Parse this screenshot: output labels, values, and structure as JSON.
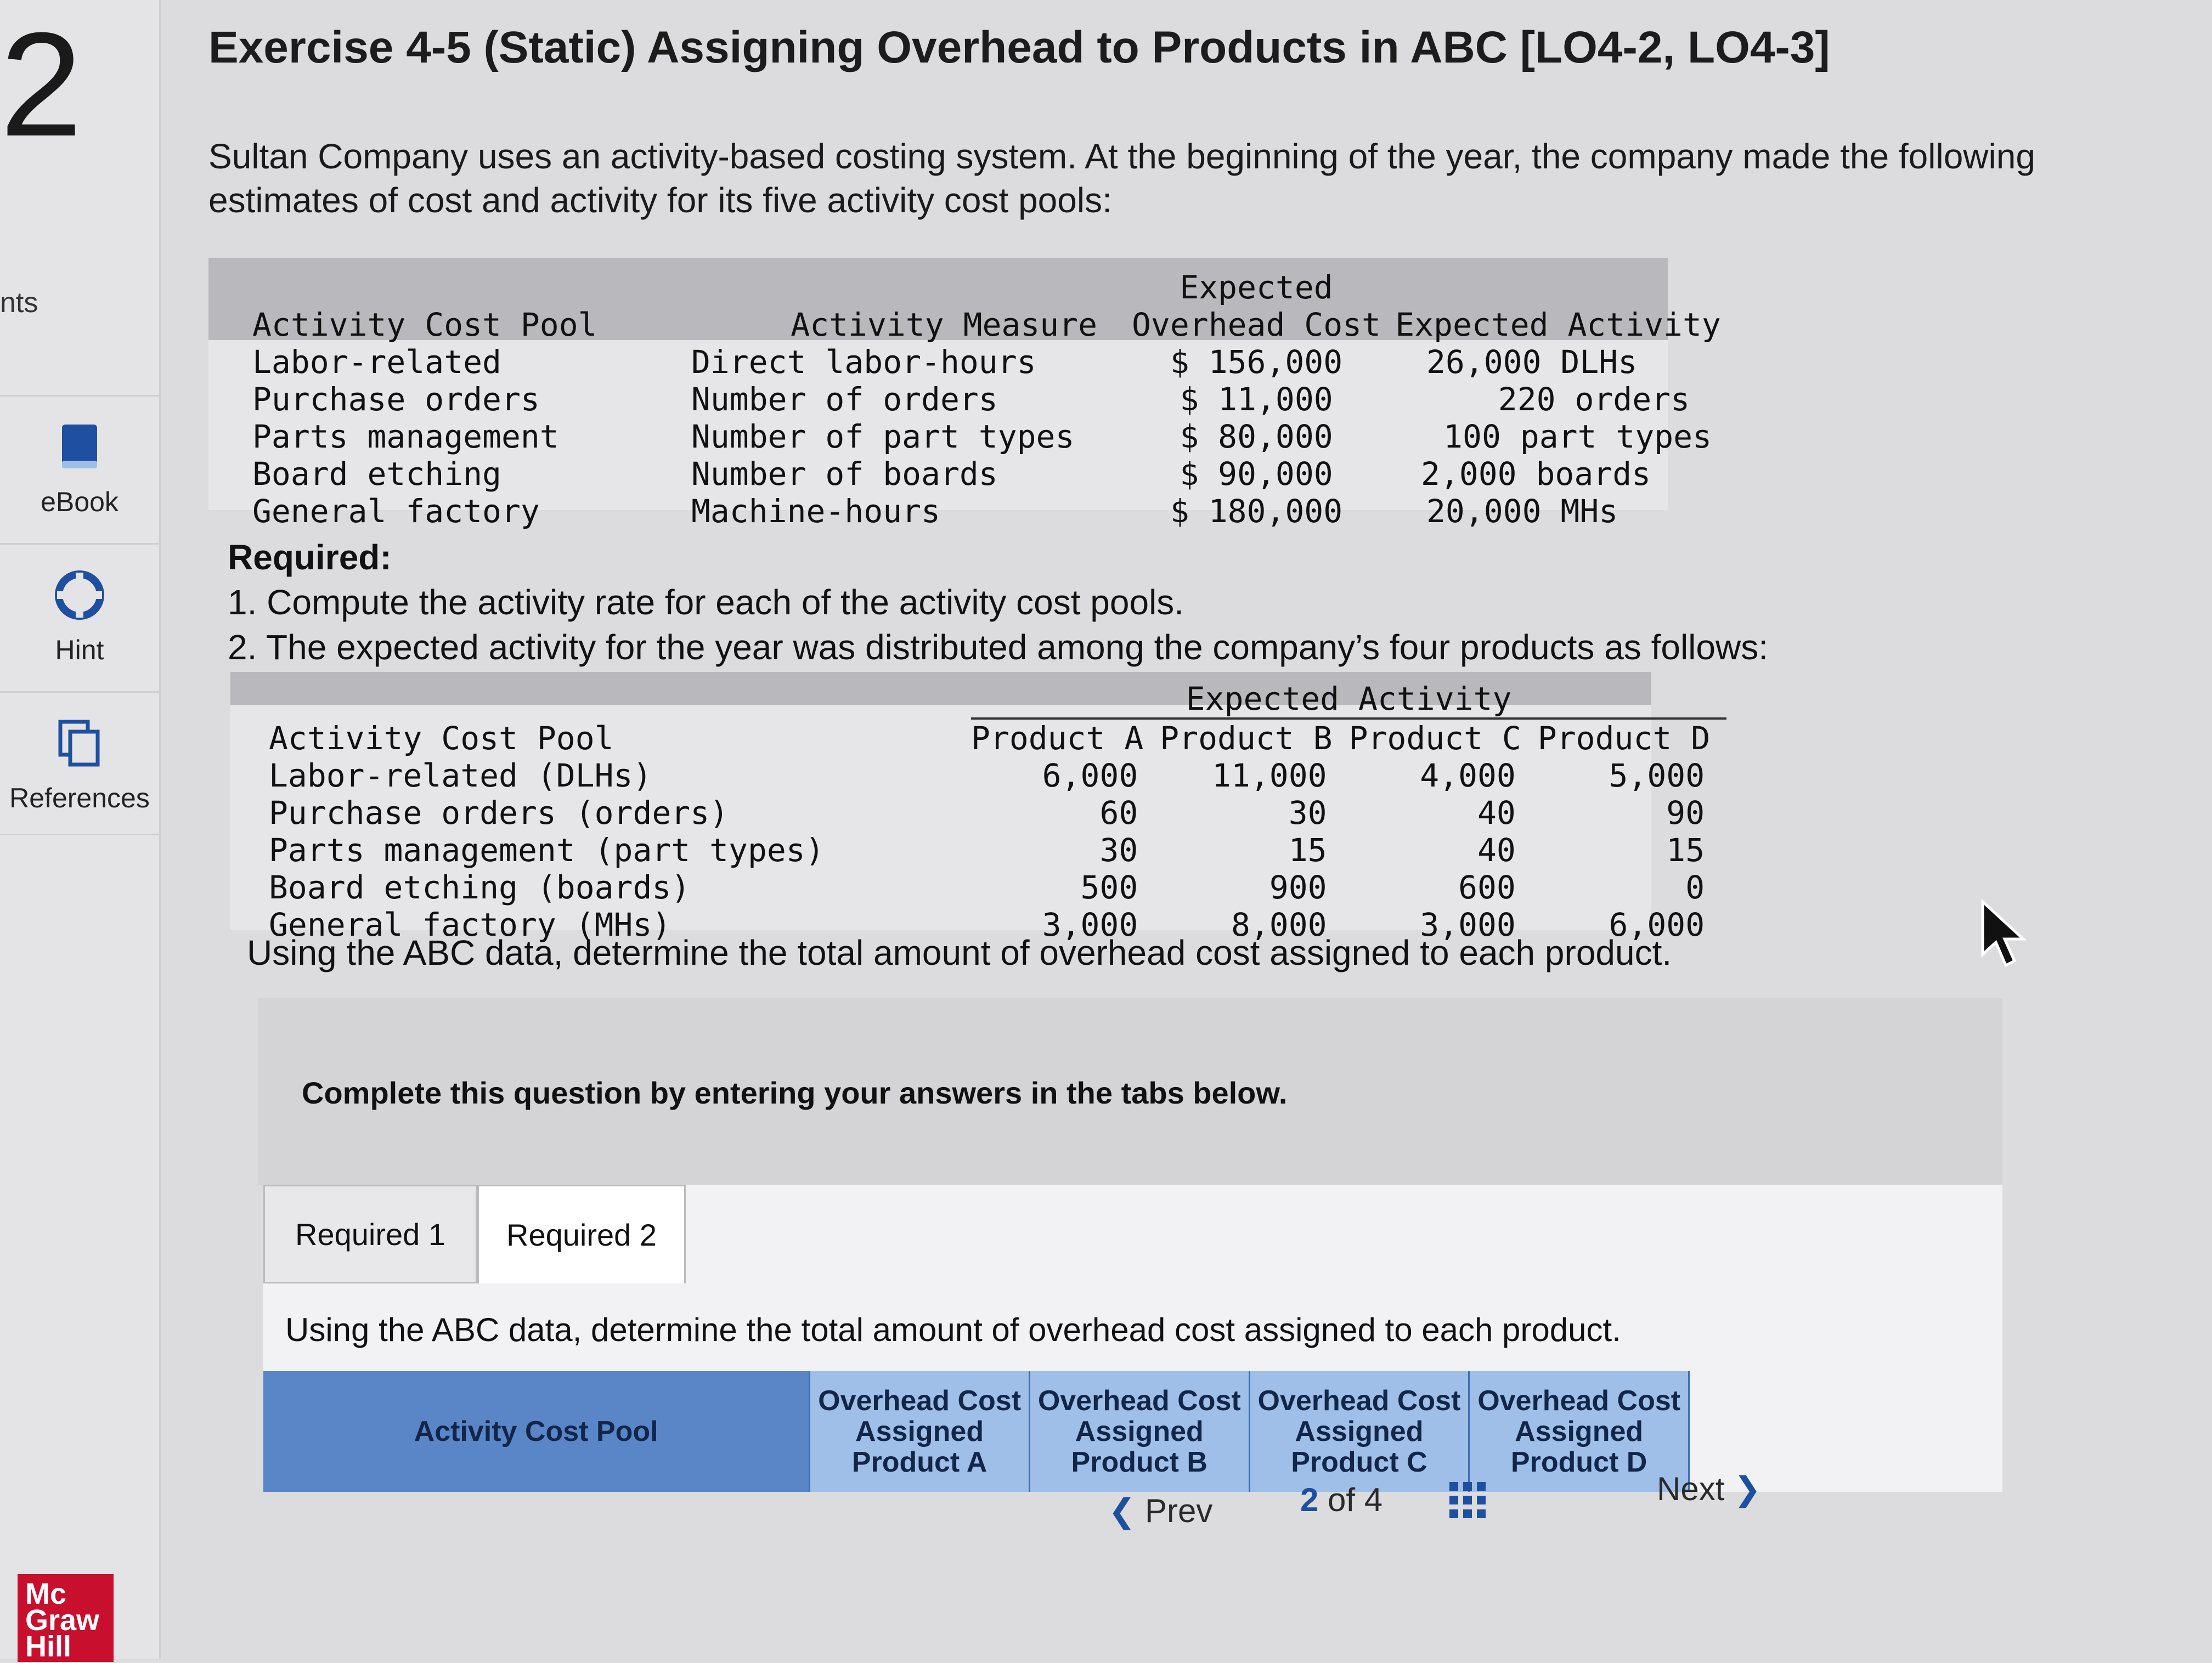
{
  "sidebar": {
    "question_number": "2",
    "points_fragment": "nts",
    "items": [
      {
        "label": "eBook",
        "icon": "book-icon"
      },
      {
        "label": "Hint",
        "icon": "lifebuoy-icon"
      },
      {
        "label": "References",
        "icon": "copy-pages-icon"
      }
    ],
    "logo_lines": [
      "Mc",
      "Graw",
      "Hill"
    ]
  },
  "title": "Exercise 4-5 (Static) Assigning Overhead to Products in ABC [LO4-2, LO4-3]",
  "intro": "Sultan Company uses an activity-based costing system. At the beginning of the year, the company made the following estimates of cost and activity for its five activity cost pools:",
  "table1": {
    "headers": [
      "Activity Cost Pool",
      "Activity Measure",
      "Expected\nOverhead Cost",
      "Expected Activity"
    ],
    "rows": [
      [
        "Labor-related",
        "Direct labor-hours",
        "$ 156,000",
        "26,000 DLHs"
      ],
      [
        "Purchase orders",
        "Number of orders",
        "$ 11,000",
        "220 orders"
      ],
      [
        "Parts management",
        "Number of part types",
        "$ 80,000",
        "100 part types"
      ],
      [
        "Board etching",
        "Number of boards",
        "$ 90,000",
        "2,000 boards"
      ],
      [
        "General factory",
        "Machine-hours",
        "$ 180,000",
        "20,000 MHs"
      ]
    ]
  },
  "required": {
    "heading": "Required:",
    "item1": "1. Compute the activity rate for each of the activity cost pools.",
    "item2": "2. The expected activity for the year was distributed among the company’s four products as follows:"
  },
  "table2": {
    "group_header": "Expected Activity",
    "headers": [
      "Activity Cost Pool",
      "Product A",
      "Product B",
      "Product C",
      "Product D"
    ],
    "rows": [
      [
        "Labor-related (DLHs)",
        "6,000",
        "11,000",
        "4,000",
        "5,000"
      ],
      [
        "Purchase orders (orders)",
        "60",
        "30",
        "40",
        "90"
      ],
      [
        "Parts management (part types)",
        "30",
        "15",
        "40",
        "15"
      ],
      [
        "Board etching (boards)",
        "500",
        "900",
        "600",
        "0"
      ],
      [
        "General factory (MHs)",
        "3,000",
        "8,000",
        "3,000",
        "6,000"
      ]
    ]
  },
  "using_text": "Using the ABC data, determine the total amount of overhead cost assigned to each product.",
  "complete_text": "Complete this question by entering your answers in the tabs below.",
  "tabs": [
    "Required 1",
    "Required 2"
  ],
  "tab_prompt": "Using the ABC data, determine the total amount of overhead cost assigned to each product.",
  "answer_table": {
    "col_pool": "Activity Cost Pool",
    "cols": [
      [
        "Overhead Cost",
        "Assigned",
        "Product A"
      ],
      [
        "Overhead Cost",
        "Assigned",
        "Product B"
      ],
      [
        "Overhead Cost",
        "Assigned",
        "Product C"
      ],
      [
        "Overhead Cost",
        "Assigned",
        "Product D"
      ]
    ]
  },
  "nav": {
    "prev": "Prev",
    "page_current": "2",
    "page_of": "of",
    "page_total": "4",
    "next": "Next"
  },
  "colors": {
    "header_blue": "#5a86c8",
    "header_light_blue": "#9fbfe8",
    "brand_red": "#c8102e",
    "nav_blue": "#1f4fa0"
  }
}
